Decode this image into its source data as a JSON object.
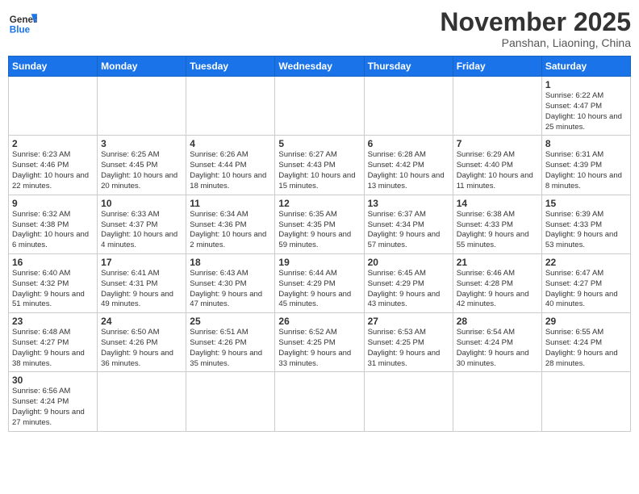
{
  "logo": {
    "general": "General",
    "blue": "Blue"
  },
  "header": {
    "month": "November 2025",
    "location": "Panshan, Liaoning, China"
  },
  "weekdays": [
    "Sunday",
    "Monday",
    "Tuesday",
    "Wednesday",
    "Thursday",
    "Friday",
    "Saturday"
  ],
  "weeks": [
    [
      {
        "day": "",
        "info": ""
      },
      {
        "day": "",
        "info": ""
      },
      {
        "day": "",
        "info": ""
      },
      {
        "day": "",
        "info": ""
      },
      {
        "day": "",
        "info": ""
      },
      {
        "day": "",
        "info": ""
      },
      {
        "day": "1",
        "info": "Sunrise: 6:22 AM\nSunset: 4:47 PM\nDaylight: 10 hours and 25 minutes."
      }
    ],
    [
      {
        "day": "2",
        "info": "Sunrise: 6:23 AM\nSunset: 4:46 PM\nDaylight: 10 hours and 22 minutes."
      },
      {
        "day": "3",
        "info": "Sunrise: 6:25 AM\nSunset: 4:45 PM\nDaylight: 10 hours and 20 minutes."
      },
      {
        "day": "4",
        "info": "Sunrise: 6:26 AM\nSunset: 4:44 PM\nDaylight: 10 hours and 18 minutes."
      },
      {
        "day": "5",
        "info": "Sunrise: 6:27 AM\nSunset: 4:43 PM\nDaylight: 10 hours and 15 minutes."
      },
      {
        "day": "6",
        "info": "Sunrise: 6:28 AM\nSunset: 4:42 PM\nDaylight: 10 hours and 13 minutes."
      },
      {
        "day": "7",
        "info": "Sunrise: 6:29 AM\nSunset: 4:40 PM\nDaylight: 10 hours and 11 minutes."
      },
      {
        "day": "8",
        "info": "Sunrise: 6:31 AM\nSunset: 4:39 PM\nDaylight: 10 hours and 8 minutes."
      }
    ],
    [
      {
        "day": "9",
        "info": "Sunrise: 6:32 AM\nSunset: 4:38 PM\nDaylight: 10 hours and 6 minutes."
      },
      {
        "day": "10",
        "info": "Sunrise: 6:33 AM\nSunset: 4:37 PM\nDaylight: 10 hours and 4 minutes."
      },
      {
        "day": "11",
        "info": "Sunrise: 6:34 AM\nSunset: 4:36 PM\nDaylight: 10 hours and 2 minutes."
      },
      {
        "day": "12",
        "info": "Sunrise: 6:35 AM\nSunset: 4:35 PM\nDaylight: 9 hours and 59 minutes."
      },
      {
        "day": "13",
        "info": "Sunrise: 6:37 AM\nSunset: 4:34 PM\nDaylight: 9 hours and 57 minutes."
      },
      {
        "day": "14",
        "info": "Sunrise: 6:38 AM\nSunset: 4:33 PM\nDaylight: 9 hours and 55 minutes."
      },
      {
        "day": "15",
        "info": "Sunrise: 6:39 AM\nSunset: 4:33 PM\nDaylight: 9 hours and 53 minutes."
      }
    ],
    [
      {
        "day": "16",
        "info": "Sunrise: 6:40 AM\nSunset: 4:32 PM\nDaylight: 9 hours and 51 minutes."
      },
      {
        "day": "17",
        "info": "Sunrise: 6:41 AM\nSunset: 4:31 PM\nDaylight: 9 hours and 49 minutes."
      },
      {
        "day": "18",
        "info": "Sunrise: 6:43 AM\nSunset: 4:30 PM\nDaylight: 9 hours and 47 minutes."
      },
      {
        "day": "19",
        "info": "Sunrise: 6:44 AM\nSunset: 4:29 PM\nDaylight: 9 hours and 45 minutes."
      },
      {
        "day": "20",
        "info": "Sunrise: 6:45 AM\nSunset: 4:29 PM\nDaylight: 9 hours and 43 minutes."
      },
      {
        "day": "21",
        "info": "Sunrise: 6:46 AM\nSunset: 4:28 PM\nDaylight: 9 hours and 42 minutes."
      },
      {
        "day": "22",
        "info": "Sunrise: 6:47 AM\nSunset: 4:27 PM\nDaylight: 9 hours and 40 minutes."
      }
    ],
    [
      {
        "day": "23",
        "info": "Sunrise: 6:48 AM\nSunset: 4:27 PM\nDaylight: 9 hours and 38 minutes."
      },
      {
        "day": "24",
        "info": "Sunrise: 6:50 AM\nSunset: 4:26 PM\nDaylight: 9 hours and 36 minutes."
      },
      {
        "day": "25",
        "info": "Sunrise: 6:51 AM\nSunset: 4:26 PM\nDaylight: 9 hours and 35 minutes."
      },
      {
        "day": "26",
        "info": "Sunrise: 6:52 AM\nSunset: 4:25 PM\nDaylight: 9 hours and 33 minutes."
      },
      {
        "day": "27",
        "info": "Sunrise: 6:53 AM\nSunset: 4:25 PM\nDaylight: 9 hours and 31 minutes."
      },
      {
        "day": "28",
        "info": "Sunrise: 6:54 AM\nSunset: 4:24 PM\nDaylight: 9 hours and 30 minutes."
      },
      {
        "day": "29",
        "info": "Sunrise: 6:55 AM\nSunset: 4:24 PM\nDaylight: 9 hours and 28 minutes."
      }
    ],
    [
      {
        "day": "30",
        "info": "Sunrise: 6:56 AM\nSunset: 4:24 PM\nDaylight: 9 hours and 27 minutes."
      },
      {
        "day": "",
        "info": ""
      },
      {
        "day": "",
        "info": ""
      },
      {
        "day": "",
        "info": ""
      },
      {
        "day": "",
        "info": ""
      },
      {
        "day": "",
        "info": ""
      },
      {
        "day": "",
        "info": ""
      }
    ]
  ]
}
